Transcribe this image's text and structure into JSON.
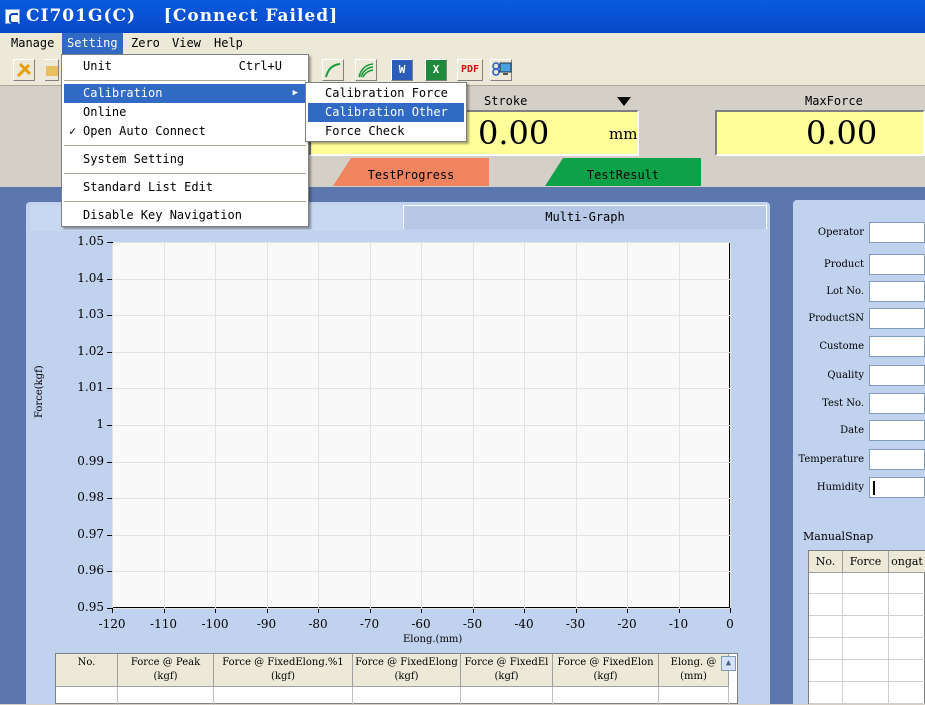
{
  "window": {
    "title": "CI701G(C)    [Connect Failed]"
  },
  "menubar": {
    "items": [
      "Manage",
      "Setting",
      "Zero",
      "View",
      "Help"
    ],
    "active": "Setting"
  },
  "setting_menu": {
    "unit": "Unit",
    "unit_shortcut": "Ctrl+U",
    "calibration": "Calibration",
    "online": "Online",
    "open_auto_connect": "Open Auto Connect",
    "open_auto_connect_check": "✓",
    "system_setting": "System Setting",
    "standard_list_edit": "Standard List Edit",
    "disable_key_navigation": "Disable Key Navigation"
  },
  "calibration_submenu": {
    "items": [
      "Calibration Force",
      "Calibration Other",
      "Force Check"
    ],
    "active": "Calibration Other"
  },
  "toolbar": {
    "word_icon_text": "W",
    "excel_icon_text": "X",
    "pdf_icon_text": "PDF"
  },
  "readouts": {
    "stroke": {
      "label": "Stroke",
      "value": "0.00",
      "unit": "mm"
    },
    "max_force": {
      "label": "MaxForce",
      "value": "0.00"
    }
  },
  "process_tabs": {
    "progress": "TestProgress",
    "result": "TestResult",
    "progress_color": "#f0845e",
    "result_color": "#0fa04a"
  },
  "graph_tabs": {
    "multi": "Multi-Graph"
  },
  "chart_data": {
    "type": "line",
    "title": "",
    "xlabel": "Elong.(mm)",
    "ylabel": "Force(kgf)",
    "xlim": [
      -120,
      0
    ],
    "ylim": [
      0.95,
      1.05
    ],
    "x_ticks": [
      "-120",
      "-110",
      "-100",
      "-90",
      "-80",
      "-70",
      "-60",
      "-50",
      "-40",
      "-30",
      "-20",
      "-10",
      "0"
    ],
    "y_ticks": [
      "1.05",
      "1.04",
      "1.03",
      "1.02",
      "1.01",
      "1",
      "0.99",
      "0.98",
      "0.97",
      "0.96",
      "0.95"
    ],
    "grid": true,
    "series": []
  },
  "result_table": {
    "headers": [
      [
        "No.",
        ""
      ],
      [
        "Force @ Peak",
        "(kgf)"
      ],
      [
        "Force @ FixedElong.%1",
        "(kgf)"
      ],
      [
        "Force @ FixedElong",
        "(kgf)"
      ],
      [
        "Force @ FixedEl",
        "(kgf)"
      ],
      [
        "Force @ FixedElon",
        "(kgf)"
      ],
      [
        "Elong. @",
        "(mm)"
      ]
    ]
  },
  "info_fields": [
    "Operator",
    "Product",
    "Lot No.",
    "ProductSN",
    "Custome",
    "Quality",
    "Test No.",
    "Date",
    "Temperature",
    "Humidity"
  ],
  "manual_snap": {
    "label": "ManualSnap",
    "headers": [
      "No.",
      "Force",
      "ongat"
    ]
  }
}
